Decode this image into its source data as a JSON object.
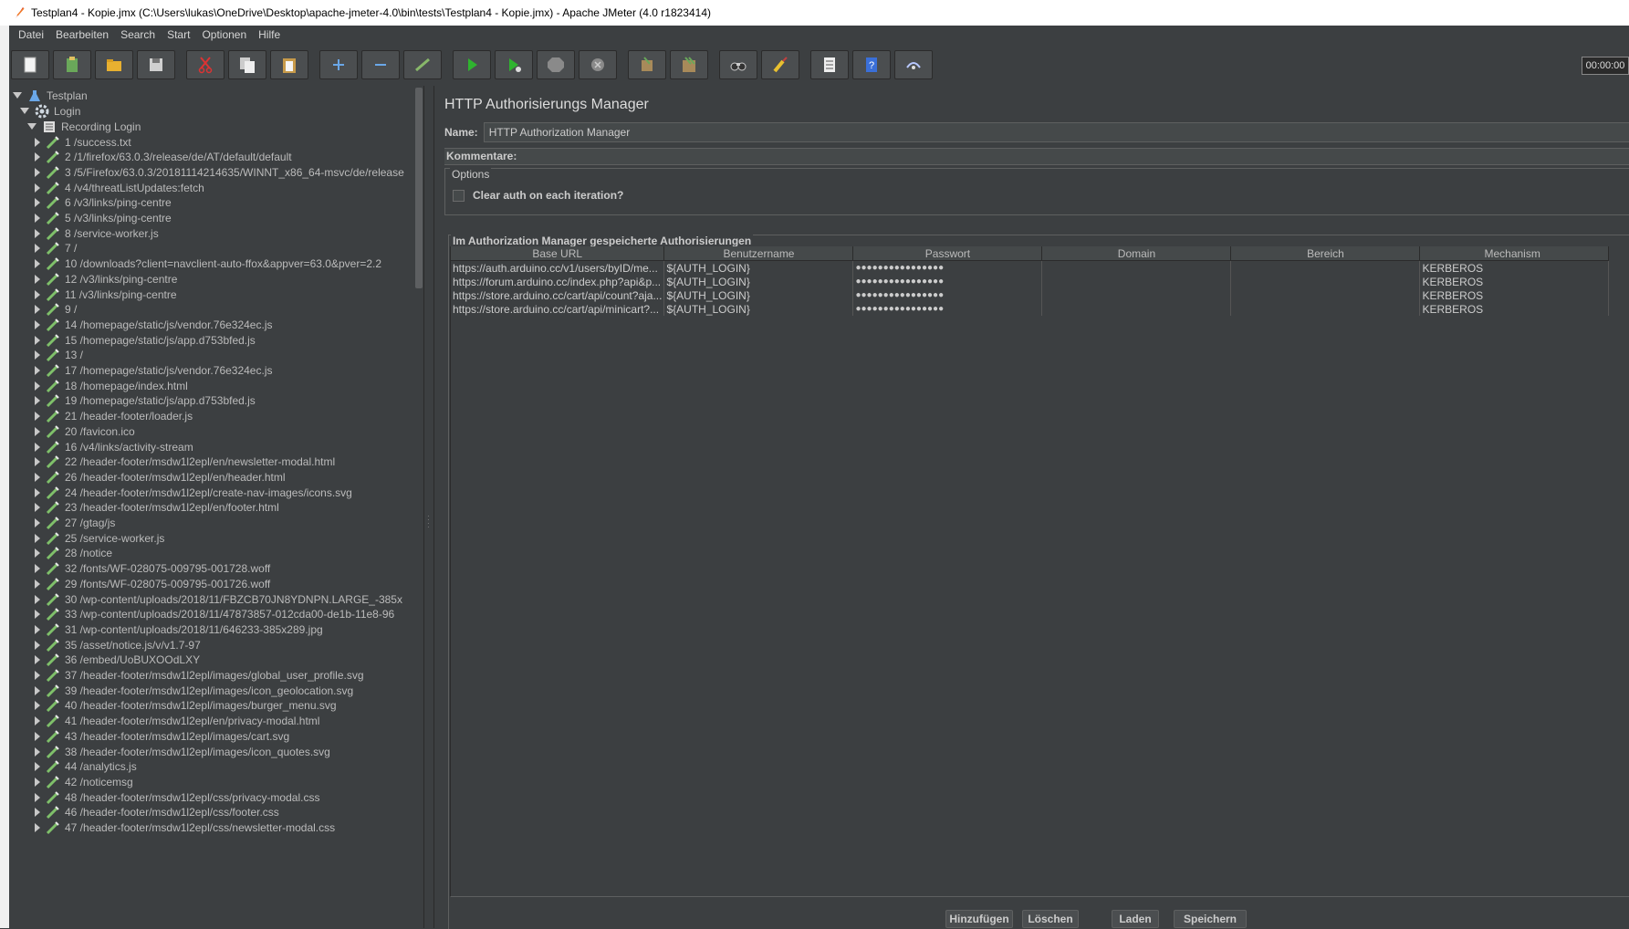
{
  "window": {
    "title": "Testplan4 - Kopie.jmx (C:\\Users\\lukas\\OneDrive\\Desktop\\apache-jmeter-4.0\\bin\\tests\\Testplan4 - Kopie.jmx) - Apache JMeter (4.0 r1823414)"
  },
  "menu": [
    "Datei",
    "Bearbeiten",
    "Search",
    "Start",
    "Optionen",
    "Hilfe"
  ],
  "toolbar": {
    "timer": "00:00:00",
    "buttons": [
      "new-icon",
      "templates-icon",
      "open-icon",
      "save-icon",
      "cut-icon",
      "copy-icon",
      "paste-icon",
      "expand-icon",
      "collapse-icon",
      "toggle-icon",
      "start-icon",
      "start-no-pause-icon",
      "stop-icon",
      "shutdown-icon",
      "clear-icon",
      "clear-all-icon",
      "search-icon",
      "reset-search-icon",
      "function-helper-icon",
      "help-icon",
      "remote-icon"
    ]
  },
  "tree": {
    "root": "Testplan",
    "thread_group": "Login",
    "controller": "Recording Login",
    "samplers": [
      "1 /success.txt",
      "2 /1/firefox/63.0.3/release/de/AT/default/default",
      "3 /5/Firefox/63.0.3/20181114214635/WINNT_x86_64-msvc/de/release",
      "4 /v4/threatListUpdates:fetch",
      "6 /v3/links/ping-centre",
      "5 /v3/links/ping-centre",
      "8 /service-worker.js",
      "7 /",
      "10 /downloads?client=navclient-auto-ffox&appver=63.0&pver=2.2",
      "12 /v3/links/ping-centre",
      "11 /v3/links/ping-centre",
      "9 /",
      "14 /homepage/static/js/vendor.76e324ec.js",
      "15 /homepage/static/js/app.d753bfed.js",
      "13 /",
      "17 /homepage/static/js/vendor.76e324ec.js",
      "18 /homepage/index.html",
      "19 /homepage/static/js/app.d753bfed.js",
      "21 /header-footer/loader.js",
      "20 /favicon.ico",
      "16 /v4/links/activity-stream",
      "22 /header-footer/msdw1l2epl/en/newsletter-modal.html",
      "26 /header-footer/msdw1l2epl/en/header.html",
      "24 /header-footer/msdw1l2epl/create-nav-images/icons.svg",
      "23 /header-footer/msdw1l2epl/en/footer.html",
      "27 /gtag/js",
      "25 /service-worker.js",
      "28 /notice",
      "32 /fonts/WF-028075-009795-001728.woff",
      "29 /fonts/WF-028075-009795-001726.woff",
      "30 /wp-content/uploads/2018/11/FBZCB70JN8YDNPN.LARGE_-385x",
      "33 /wp-content/uploads/2018/11/47873857-012cda00-de1b-11e8-96",
      "31 /wp-content/uploads/2018/11/646233-385x289.jpg",
      "35 /asset/notice.js/v/v1.7-97",
      "36 /embed/UoBUXOOdLXY",
      "37 /header-footer/msdw1l2epl/images/global_user_profile.svg",
      "39 /header-footer/msdw1l2epl/images/icon_geolocation.svg",
      "40 /header-footer/msdw1l2epl/images/burger_menu.svg",
      "41 /header-footer/msdw1l2epl/en/privacy-modal.html",
      "43 /header-footer/msdw1l2epl/images/cart.svg",
      "38 /header-footer/msdw1l2epl/images/icon_quotes.svg",
      "44 /analytics.js",
      "42 /noticemsg",
      "48 /header-footer/msdw1l2epl/css/privacy-modal.css",
      "46 /header-footer/msdw1l2epl/css/footer.css",
      "47 /header-footer/msdw1l2epl/css/newsletter-modal.css"
    ]
  },
  "panel": {
    "title": "HTTP Authorisierungs Manager",
    "name_label": "Name:",
    "name_value": "HTTP Authorization Manager",
    "comment_label": "Kommentare:",
    "options_legend": "Options",
    "clear_auth_label": "Clear auth on each iteration?",
    "table_legend": "Im Authorization Manager gespeicherte Authorisierungen",
    "columns": [
      "Base URL",
      "Benutzername",
      "Passwort",
      "Domain",
      "Bereich",
      "Mechanism"
    ],
    "rows": [
      [
        "https://auth.arduino.cc/v1/users/byID/me...",
        "${AUTH_LOGIN}",
        "●●●●●●●●●●●●●●●●",
        "",
        "",
        "KERBEROS"
      ],
      [
        "https://forum.arduino.cc/index.php?api&p...",
        "${AUTH_LOGIN}",
        "●●●●●●●●●●●●●●●●",
        "",
        "",
        "KERBEROS"
      ],
      [
        "https://store.arduino.cc/cart/api/count?aja...",
        "${AUTH_LOGIN}",
        "●●●●●●●●●●●●●●●●",
        "",
        "",
        "KERBEROS"
      ],
      [
        "https://store.arduino.cc/cart/api/minicart?...",
        "${AUTH_LOGIN}",
        "●●●●●●●●●●●●●●●●",
        "",
        "",
        "KERBEROS"
      ]
    ],
    "buttons": {
      "add": "Hinzufügen",
      "delete": "Löschen",
      "load": "Laden",
      "save": "Speichern"
    }
  }
}
